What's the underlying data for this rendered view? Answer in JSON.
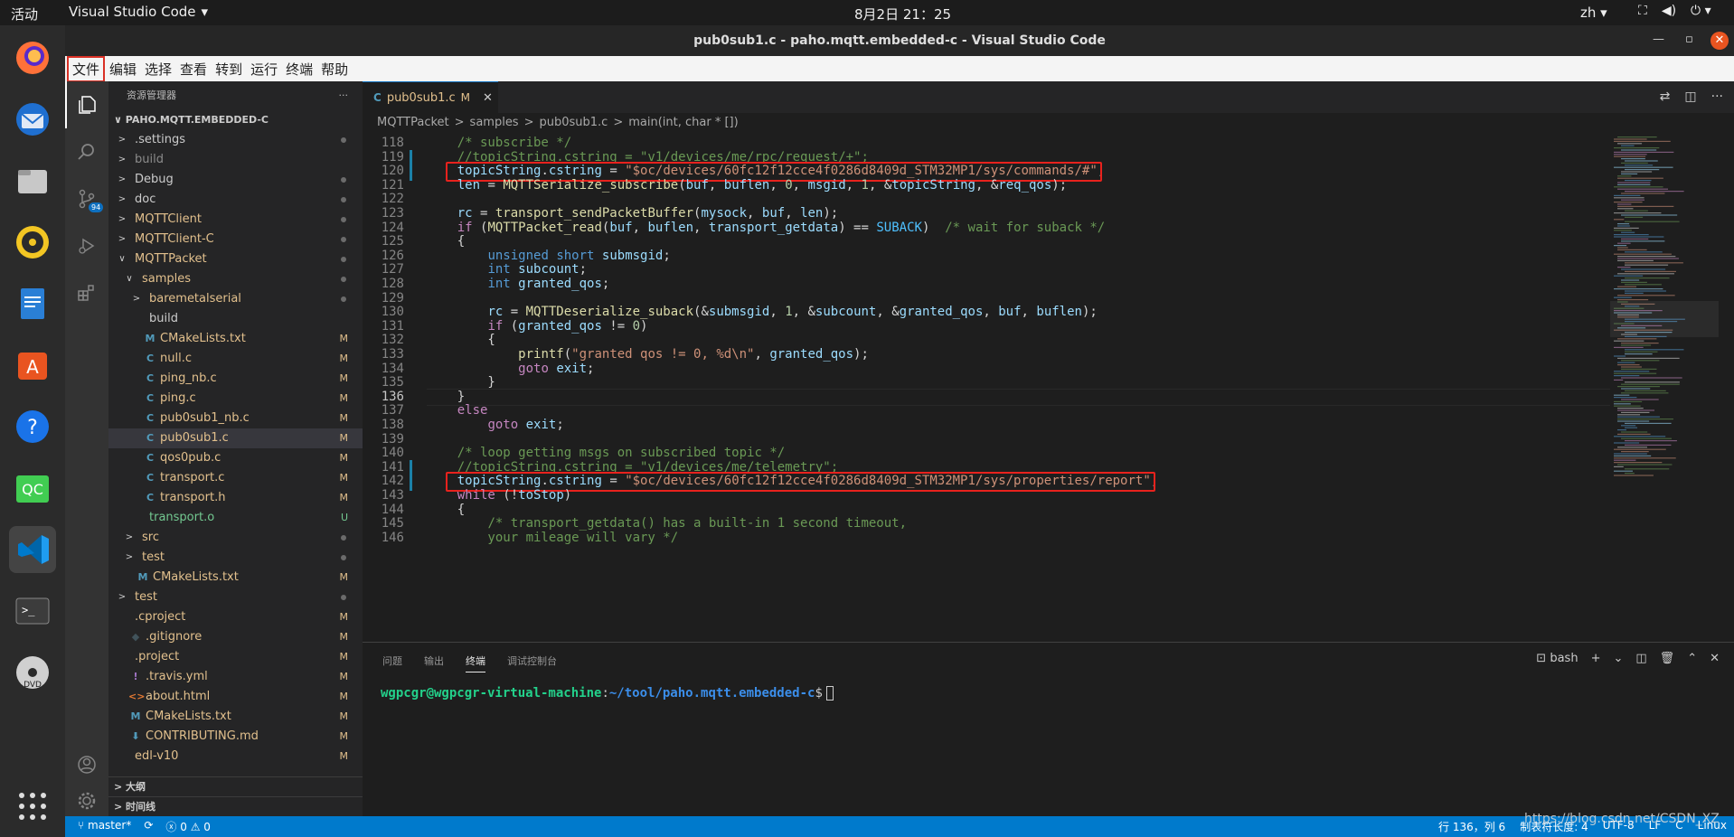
{
  "system": {
    "activities": "活动",
    "app_name": "Visual Studio Code",
    "clock": "8月2日  21：25",
    "lang": "zh",
    "icons": [
      "network-icon",
      "volume-icon",
      "power-icon"
    ]
  },
  "dock": {
    "apps": [
      "firefox-icon",
      "thunderbird-icon",
      "files-icon",
      "rhythmbox-icon",
      "writer-icon",
      "appcenter-icon",
      "help-icon",
      "qtcreator-icon",
      "vscode-icon",
      "terminal-icon",
      "dvd-icon",
      "show-apps-icon"
    ],
    "qc_label": "QC"
  },
  "window": {
    "title": "pub0sub1.c - paho.mqtt.embedded-c - Visual Studio Code"
  },
  "menu": [
    "文件",
    "编辑",
    "选择",
    "查看",
    "转到",
    "运行",
    "终端",
    "帮助"
  ],
  "activity": {
    "scm_badge": "94"
  },
  "sidebar": {
    "header": "资源管理器",
    "root": "PAHO.MQTT.EMBEDDED-C",
    "outline": "大纲",
    "timeline": "时间线",
    "items": [
      {
        "name": ".settings",
        "depth": 0,
        "chev": ">",
        "icon": "",
        "status": "dot",
        "color": "#cccccc"
      },
      {
        "name": "build",
        "depth": 0,
        "chev": ">",
        "icon": "",
        "status": "",
        "color": "#8b8b8b"
      },
      {
        "name": "Debug",
        "depth": 0,
        "chev": ">",
        "icon": "",
        "status": "dot",
        "color": "#cccccc"
      },
      {
        "name": "doc",
        "depth": 0,
        "chev": ">",
        "icon": "",
        "status": "dot",
        "color": "#cccccc"
      },
      {
        "name": "MQTTClient",
        "depth": 0,
        "chev": ">",
        "icon": "",
        "status": "dot",
        "color": "#e2c08d"
      },
      {
        "name": "MQTTClient-C",
        "depth": 0,
        "chev": ">",
        "icon": "",
        "status": "dot",
        "color": "#e2c08d"
      },
      {
        "name": "MQTTPacket",
        "depth": 0,
        "chev": "v",
        "icon": "",
        "status": "dot",
        "color": "#e2c08d"
      },
      {
        "name": "samples",
        "depth": 1,
        "chev": "v",
        "icon": "",
        "status": "dot",
        "color": "#e2c08d"
      },
      {
        "name": "baremetalserial",
        "depth": 2,
        "chev": ">",
        "icon": "",
        "status": "dot",
        "color": "#e2c08d"
      },
      {
        "name": "build",
        "depth": 2,
        "chev": "",
        "icon": "",
        "status": "",
        "color": "#cccccc"
      },
      {
        "name": "CMakeLists.txt",
        "depth": 2,
        "chev": "",
        "icon": "M",
        "status": "M",
        "color": "#e2c08d"
      },
      {
        "name": "null.c",
        "depth": 2,
        "chev": "",
        "icon": "C",
        "status": "M",
        "color": "#e2c08d"
      },
      {
        "name": "ping_nb.c",
        "depth": 2,
        "chev": "",
        "icon": "C",
        "status": "M",
        "color": "#e2c08d"
      },
      {
        "name": "ping.c",
        "depth": 2,
        "chev": "",
        "icon": "C",
        "status": "M",
        "color": "#e2c08d"
      },
      {
        "name": "pub0sub1_nb.c",
        "depth": 2,
        "chev": "",
        "icon": "C",
        "status": "M",
        "color": "#e2c08d"
      },
      {
        "name": "pub0sub1.c",
        "depth": 2,
        "chev": "",
        "icon": "C",
        "status": "M",
        "color": "#e2c08d",
        "selected": true
      },
      {
        "name": "qos0pub.c",
        "depth": 2,
        "chev": "",
        "icon": "C",
        "status": "M",
        "color": "#e2c08d"
      },
      {
        "name": "transport.c",
        "depth": 2,
        "chev": "",
        "icon": "C",
        "status": "M",
        "color": "#e2c08d"
      },
      {
        "name": "transport.h",
        "depth": 2,
        "chev": "",
        "icon": "C",
        "status": "M",
        "color": "#e2c08d"
      },
      {
        "name": "transport.o",
        "depth": 2,
        "chev": "",
        "icon": "",
        "status": "U",
        "color": "#73c991"
      },
      {
        "name": "src",
        "depth": 1,
        "chev": ">",
        "icon": "",
        "status": "dot",
        "color": "#e2c08d"
      },
      {
        "name": "test",
        "depth": 1,
        "chev": ">",
        "icon": "",
        "status": "dot",
        "color": "#e2c08d"
      },
      {
        "name": "CMakeLists.txt",
        "depth": 1,
        "chev": "",
        "icon": "M",
        "status": "M",
        "color": "#e2c08d"
      },
      {
        "name": "test",
        "depth": 0,
        "chev": ">",
        "icon": "",
        "status": "dot",
        "color": "#e2c08d"
      },
      {
        "name": ".cproject",
        "depth": 0,
        "chev": "",
        "icon": "",
        "status": "M",
        "color": "#e2c08d"
      },
      {
        "name": ".gitignore",
        "depth": 0,
        "chev": "",
        "icon": "◆",
        "status": "M",
        "color": "#e2c08d"
      },
      {
        "name": ".project",
        "depth": 0,
        "chev": "",
        "icon": "",
        "status": "M",
        "color": "#e2c08d"
      },
      {
        "name": ".travis.yml",
        "depth": 0,
        "chev": "",
        "icon": "!",
        "status": "M",
        "color": "#e2c08d"
      },
      {
        "name": "about.html",
        "depth": 0,
        "chev": "",
        "icon": "<>",
        "status": "M",
        "color": "#e2c08d"
      },
      {
        "name": "CMakeLists.txt",
        "depth": 0,
        "chev": "",
        "icon": "M",
        "status": "M",
        "color": "#e2c08d"
      },
      {
        "name": "CONTRIBUTING.md",
        "depth": 0,
        "chev": "",
        "icon": "⬇",
        "status": "M",
        "color": "#e2c08d"
      },
      {
        "name": "edl-v10",
        "depth": 0,
        "chev": "",
        "icon": "",
        "status": "M",
        "color": "#e2c08d"
      }
    ]
  },
  "editor": {
    "tab_name": "pub0sub1.c",
    "tab_status": "M",
    "breadcrumbs": [
      "MQTTPacket",
      ">",
      "samples",
      ">",
      "pub0sub1.c",
      ">",
      "main(int, char * [])"
    ],
    "first_line": 118,
    "current_line": 136,
    "lines": [
      "    /* subscribe */",
      "    //topicString.cstring = \"v1/devices/me/rpc/request/+\";",
      "    topicString.cstring = \"$oc/devices/60fc12f12cce4f0286d8409d_STM32MP1/sys/commands/#\";",
      "    len = MQTTSerialize_subscribe(buf, buflen, 0, msgid, 1, &topicString, &req_qos);",
      "",
      "    rc = transport_sendPacketBuffer(mysock, buf, len);",
      "    if (MQTTPacket_read(buf, buflen, transport_getdata) == SUBACK)  /* wait for suback */",
      "    {",
      "        unsigned short submsgid;",
      "        int subcount;",
      "        int granted_qos;",
      "",
      "        rc = MQTTDeserialize_suback(&submsgid, 1, &subcount, &granted_qos, buf, buflen);",
      "        if (granted_qos != 0)",
      "        {",
      "            printf(\"granted qos != 0, %d\\n\", granted_qos);",
      "            goto exit;",
      "        }",
      "    }",
      "    else",
      "        goto exit;",
      "",
      "    /* loop getting msgs on subscribed topic */",
      "    //topicString.cstring = \"v1/devices/me/telemetry\";",
      "    topicString.cstring = \"$oc/devices/60fc12f12cce4f0286d8409d_STM32MP1/sys/properties/report\";",
      "    while (!toStop)",
      "    {",
      "        /* transport_getdata() has a built-in 1 second timeout,",
      "        your mileage will vary */"
    ]
  },
  "panel": {
    "tabs": [
      "问题",
      "输出",
      "终端",
      "调试控制台"
    ],
    "active_tab": "终端",
    "shell": "bash",
    "prompt_user": "wgpcgr@wgpcgr-virtual-machine",
    "prompt_path": "~/tool/paho.mqtt.embedded-c",
    "prompt_sym": "$"
  },
  "status": {
    "branch": "master*",
    "errors": "0",
    "warnings": "0",
    "position": "行 136，列 6",
    "indent": "制表符长度: 4",
    "encoding": "UTF-8",
    "eol": "LF",
    "lang": "C",
    "os": "Linux"
  },
  "watermark": "https://blog.csdn.net/CSDN_XZ"
}
